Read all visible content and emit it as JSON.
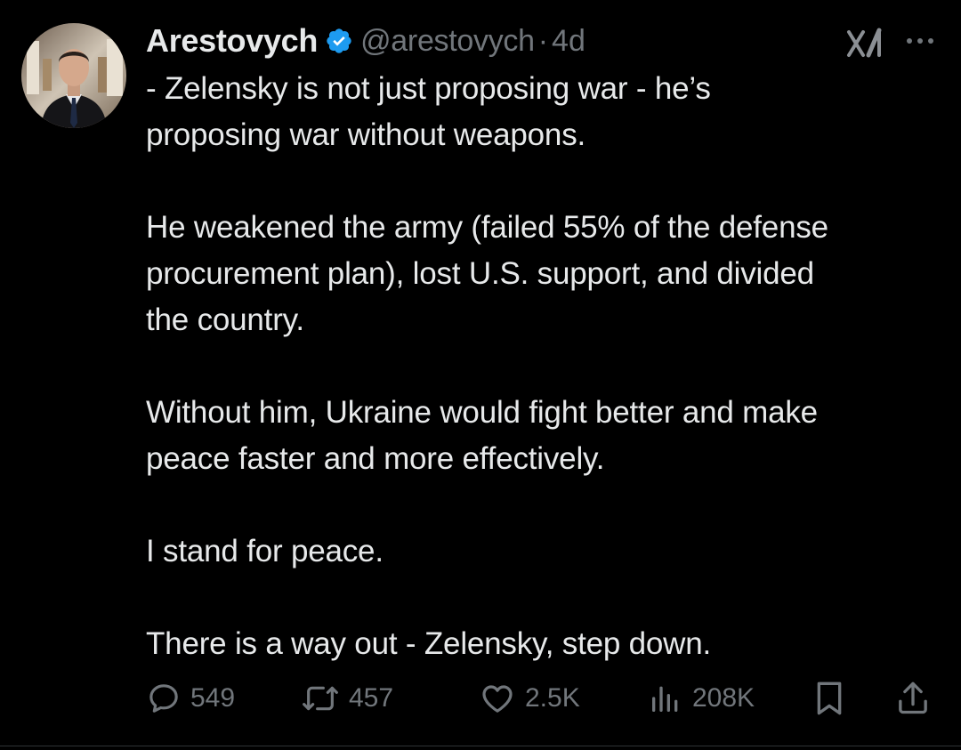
{
  "post": {
    "display_name": "Arestovych",
    "handle": "@arestovych",
    "separator": "·",
    "time": "4d",
    "paragraphs": [
      "- Zelensky is not just proposing war - he’s\nproposing war without weapons.",
      "He weakened the army (failed 55% of the defense\nprocurement plan), lost U.S. support, and divided\nthe country.",
      "Without him, Ukraine would fight better and make\npeace faster and more effectively.",
      "I stand for peace.",
      "There is a way out - Zelensky, step down."
    ]
  },
  "actions": {
    "replies": "549",
    "reposts": "457",
    "likes": "2.5K",
    "views": "208K"
  },
  "icons": {
    "verified": "verified-badge-icon",
    "grok": "grok-icon",
    "more": "more-icon",
    "reply": "reply-icon",
    "repost": "repost-icon",
    "like": "like-icon",
    "views": "views-icon",
    "bookmark": "bookmark-icon",
    "share": "share-icon"
  },
  "colors": {
    "background": "#000000",
    "text": "#e7e9ea",
    "muted": "#71767b",
    "verified": "#1d9bf0"
  }
}
